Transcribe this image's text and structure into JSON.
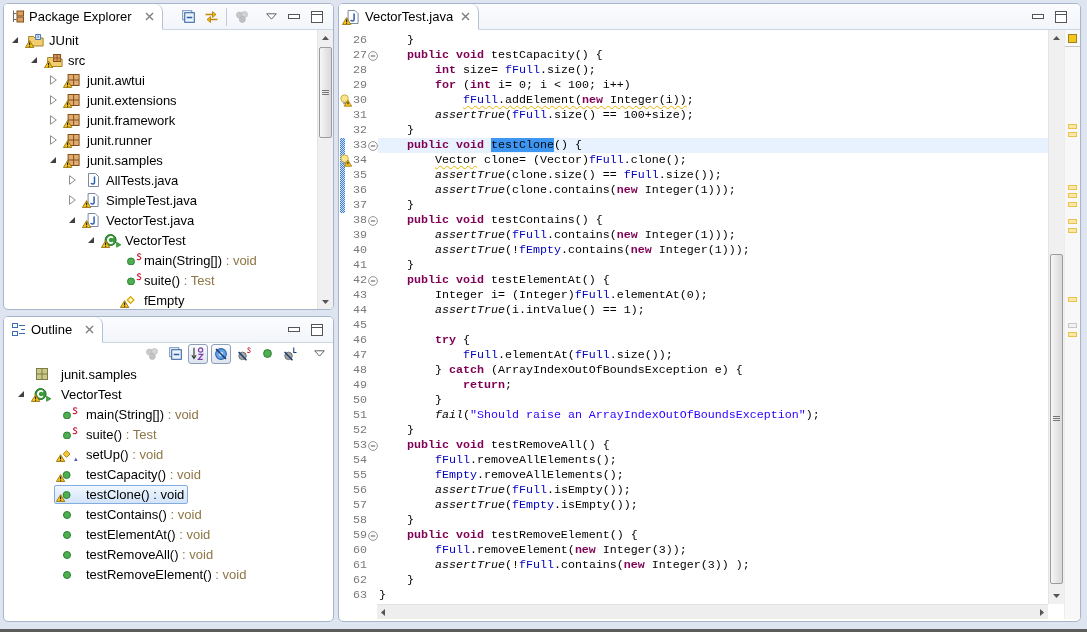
{
  "package_explorer": {
    "tab": {
      "label": "Package Explorer",
      "selected": true
    },
    "toolbar_groups": [
      {
        "items": [
          {
            "kind": "collapse-all",
            "disabled": false
          },
          {
            "kind": "link-with-editor",
            "disabled": false
          }
        ]
      },
      {
        "items": [
          {
            "kind": "focus-on-task",
            "disabled": true
          },
          {
            "kind": "view-menu",
            "disabled": false
          }
        ]
      }
    ],
    "tree": [
      {
        "label": "JUnit",
        "kind": "project",
        "warning": true,
        "expanded": true,
        "children": [
          {
            "label": "src",
            "kind": "source-folder",
            "warning": true,
            "expanded": true,
            "children": [
              {
                "label": "junit.awtui",
                "kind": "package",
                "warning": true,
                "expanded": false
              },
              {
                "label": "junit.extensions",
                "kind": "package",
                "warning": true,
                "expanded": false
              },
              {
                "label": "junit.framework",
                "kind": "package",
                "warning": true,
                "expanded": false
              },
              {
                "label": "junit.runner",
                "kind": "package",
                "warning": true,
                "expanded": false
              },
              {
                "label": "junit.samples",
                "kind": "package",
                "warning": true,
                "expanded": true,
                "children": [
                  {
                    "label": "AllTests.java",
                    "kind": "java-file",
                    "warning": false,
                    "expanded": false
                  },
                  {
                    "label": "SimpleTest.java",
                    "kind": "java-file",
                    "warning": true,
                    "expanded": false
                  },
                  {
                    "label": "VectorTest.java",
                    "kind": "java-file",
                    "warning": true,
                    "expanded": true,
                    "children": [
                      {
                        "label": "VectorTest",
                        "kind": "class",
                        "warning": true,
                        "expanded": true,
                        "children": [
                          {
                            "label": "main(String[])",
                            "detail": ": void",
                            "kind": "method",
                            "warning": false,
                            "static": true
                          },
                          {
                            "label": "suite()",
                            "detail": ": Test",
                            "kind": "method",
                            "warning": false,
                            "static": true
                          },
                          {
                            "label": "fEmpty",
                            "kind": "field",
                            "warning": true,
                            "static": false
                          }
                        ]
                      }
                    ]
                  }
                ]
              }
            ]
          }
        ]
      }
    ]
  },
  "outline": {
    "tab": {
      "label": "Outline",
      "selected": true
    },
    "toolbar": [
      {
        "kind": "focus-on-task",
        "disabled": true,
        "pressed": false
      },
      {
        "kind": "collapse-all",
        "disabled": false,
        "pressed": false
      },
      {
        "kind": "sort",
        "disabled": false,
        "pressed": true
      },
      {
        "kind": "hide-fields",
        "disabled": false,
        "pressed": true
      },
      {
        "kind": "hide-static",
        "disabled": false,
        "pressed": false
      },
      {
        "kind": "hide-non-public",
        "disabled": false,
        "pressed": false
      },
      {
        "kind": "hide-local-types",
        "disabled": false,
        "pressed": false
      },
      {
        "kind": "view-menu",
        "disabled": false,
        "pressed": false
      }
    ],
    "tree": [
      {
        "label": "junit.samples",
        "kind": "package-declaration",
        "warning": false,
        "selected": false
      },
      {
        "label": "VectorTest",
        "kind": "class",
        "warning": true,
        "selected": false,
        "expanded": true,
        "children": [
          {
            "label": "main(String[])",
            "detail": ": void",
            "kind": "method",
            "static": true,
            "override": false,
            "warning": false,
            "selected": false
          },
          {
            "label": "suite()",
            "detail": ": Test",
            "kind": "method",
            "static": true,
            "override": false,
            "warning": false,
            "selected": false
          },
          {
            "label": "setUp()",
            "detail": ": void",
            "kind": "protected-method",
            "static": false,
            "override": true,
            "warning": true,
            "selected": false
          },
          {
            "label": "testCapacity()",
            "detail": ": void",
            "kind": "method",
            "static": false,
            "override": false,
            "warning": true,
            "selected": false
          },
          {
            "label": "testClone()",
            "detail": ": void",
            "kind": "method",
            "static": false,
            "override": false,
            "warning": true,
            "selected": true
          },
          {
            "label": "testContains()",
            "detail": ": void",
            "kind": "method",
            "static": false,
            "override": false,
            "warning": false,
            "selected": false
          },
          {
            "label": "testElementAt()",
            "detail": ": void",
            "kind": "method",
            "static": false,
            "override": false,
            "warning": false,
            "selected": false
          },
          {
            "label": "testRemoveAll()",
            "detail": ": void",
            "kind": "method",
            "static": false,
            "override": false,
            "warning": false,
            "selected": false
          },
          {
            "label": "testRemoveElement()",
            "detail": ": void",
            "kind": "method",
            "static": false,
            "override": false,
            "warning": false,
            "selected": false
          }
        ]
      }
    ]
  },
  "editor": {
    "tab": {
      "label": "VectorTest.java",
      "selected": true,
      "warning": true
    },
    "lines": [
      {
        "number": "26",
        "folding": false,
        "warning": false,
        "changed": false,
        "current": false,
        "tokens": [
          {
            "text": "    }",
            "kind": "plain"
          }
        ]
      },
      {
        "number": "27",
        "folding": true,
        "warning": false,
        "changed": false,
        "current": false,
        "tokens": [
          {
            "text": "    public void ",
            "kind": "keyword"
          },
          {
            "text": "testCapacity() {",
            "kind": "plain"
          }
        ]
      },
      {
        "number": "28",
        "folding": false,
        "warning": false,
        "changed": false,
        "current": false,
        "tokens": [
          {
            "text": "        int",
            "kind": "keyword"
          },
          {
            "text": " size= ",
            "kind": "plain"
          },
          {
            "text": "fFull",
            "kind": "field"
          },
          {
            "text": ".size();",
            "kind": "plain"
          }
        ]
      },
      {
        "number": "29",
        "folding": false,
        "warning": false,
        "changed": false,
        "current": false,
        "tokens": [
          {
            "text": "        for",
            "kind": "keyword"
          },
          {
            "text": " (",
            "kind": "plain"
          },
          {
            "text": "int",
            "kind": "keyword"
          },
          {
            "text": " i= 0; i < 100; i++)",
            "kind": "plain"
          }
        ]
      },
      {
        "number": "30",
        "folding": false,
        "warning": true,
        "changed": false,
        "current": false,
        "tokens": [
          {
            "kind": "warning",
            "tokens": [
              {
                "text": "            fFull",
                "kind": "field"
              },
              {
                "text": ".addElement(",
                "kind": "plain"
              },
              {
                "text": "new",
                "kind": "keyword"
              },
              {
                "text": " Integer(i))",
                "kind": "plain"
              }
            ]
          },
          {
            "text": ";",
            "kind": "plain"
          }
        ]
      },
      {
        "number": "31",
        "folding": false,
        "warning": false,
        "changed": false,
        "current": false,
        "tokens": [
          {
            "text": "        assertTrue",
            "kind": "static"
          },
          {
            "text": "(",
            "kind": "plain"
          },
          {
            "text": "fFull",
            "kind": "field"
          },
          {
            "text": ".size() == 100+size);",
            "kind": "plain"
          }
        ]
      },
      {
        "number": "32",
        "folding": false,
        "warning": false,
        "changed": false,
        "current": false,
        "tokens": [
          {
            "text": "    }",
            "kind": "plain"
          }
        ]
      },
      {
        "number": "33",
        "folding": true,
        "warning": false,
        "changed": true,
        "current": true,
        "tokens": [
          {
            "text": "    public void ",
            "kind": "keyword"
          },
          {
            "text": "testClone",
            "kind": "selection"
          },
          {
            "text": "() {",
            "kind": "plain"
          }
        ]
      },
      {
        "number": "34",
        "folding": false,
        "warning": true,
        "changed": true,
        "current": false,
        "tokens": [
          {
            "kind": "warning",
            "tokens": [
              {
                "text": "        Vector",
                "kind": "plain"
              }
            ]
          },
          {
            "text": " clone= (Vector)",
            "kind": "plain"
          },
          {
            "text": "fFull",
            "kind": "field"
          },
          {
            "text": ".clone();",
            "kind": "plain"
          }
        ]
      },
      {
        "number": "35",
        "folding": false,
        "warning": false,
        "changed": true,
        "current": false,
        "tokens": [
          {
            "text": "        assertTrue",
            "kind": "static"
          },
          {
            "text": "(clone.size() == ",
            "kind": "plain"
          },
          {
            "text": "fFull",
            "kind": "field"
          },
          {
            "text": ".size());",
            "kind": "plain"
          }
        ]
      },
      {
        "number": "36",
        "folding": false,
        "warning": false,
        "changed": true,
        "current": false,
        "tokens": [
          {
            "text": "        assertTrue",
            "kind": "static"
          },
          {
            "text": "(clone.contains(",
            "kind": "plain"
          },
          {
            "text": "new",
            "kind": "keyword"
          },
          {
            "text": " Integer(1)));",
            "kind": "plain"
          }
        ]
      },
      {
        "number": "37",
        "folding": false,
        "warning": false,
        "changed": true,
        "current": false,
        "tokens": [
          {
            "text": "    }",
            "kind": "plain"
          }
        ]
      },
      {
        "number": "38",
        "folding": true,
        "warning": false,
        "changed": false,
        "current": false,
        "tokens": [
          {
            "text": "    public void ",
            "kind": "keyword"
          },
          {
            "text": "testContains() {",
            "kind": "plain"
          }
        ]
      },
      {
        "number": "39",
        "folding": false,
        "warning": false,
        "changed": false,
        "current": false,
        "tokens": [
          {
            "text": "        assertTrue",
            "kind": "static"
          },
          {
            "text": "(",
            "kind": "plain"
          },
          {
            "text": "fFull",
            "kind": "field"
          },
          {
            "text": ".contains(",
            "kind": "plain"
          },
          {
            "text": "new",
            "kind": "keyword"
          },
          {
            "text": " Integer(1)));",
            "kind": "plain"
          }
        ]
      },
      {
        "number": "40",
        "folding": false,
        "warning": false,
        "changed": false,
        "current": false,
        "tokens": [
          {
            "text": "        assertTrue",
            "kind": "static"
          },
          {
            "text": "(!",
            "kind": "plain"
          },
          {
            "text": "fEmpty",
            "kind": "field"
          },
          {
            "text": ".contains(",
            "kind": "plain"
          },
          {
            "text": "new",
            "kind": "keyword"
          },
          {
            "text": " Integer(1)));",
            "kind": "plain"
          }
        ]
      },
      {
        "number": "41",
        "folding": false,
        "warning": false,
        "changed": false,
        "current": false,
        "tokens": [
          {
            "text": "    }",
            "kind": "plain"
          }
        ]
      },
      {
        "number": "42",
        "folding": true,
        "warning": false,
        "changed": false,
        "current": false,
        "tokens": [
          {
            "text": "    public void ",
            "kind": "keyword"
          },
          {
            "text": "testElementAt() {",
            "kind": "plain"
          }
        ]
      },
      {
        "number": "43",
        "folding": false,
        "warning": false,
        "changed": false,
        "current": false,
        "tokens": [
          {
            "text": "        Integer i= (Integer)",
            "kind": "plain"
          },
          {
            "text": "fFull",
            "kind": "field"
          },
          {
            "text": ".elementAt(0);",
            "kind": "plain"
          }
        ]
      },
      {
        "number": "44",
        "folding": false,
        "warning": false,
        "changed": false,
        "current": false,
        "tokens": [
          {
            "text": "        assertTrue",
            "kind": "static"
          },
          {
            "text": "(i.intValue() == 1);",
            "kind": "plain"
          }
        ]
      },
      {
        "number": "45",
        "folding": false,
        "warning": false,
        "changed": false,
        "current": false
      },
      {
        "number": "46",
        "folding": false,
        "warning": false,
        "changed": false,
        "current": false,
        "tokens": [
          {
            "text": "        try",
            "kind": "keyword"
          },
          {
            "text": " {",
            "kind": "plain"
          }
        ]
      },
      {
        "number": "47",
        "folding": false,
        "warning": false,
        "changed": false,
        "current": false,
        "tokens": [
          {
            "text": "            fFull",
            "kind": "field"
          },
          {
            "text": ".elementAt(",
            "kind": "plain"
          },
          {
            "text": "fFull",
            "kind": "field"
          },
          {
            "text": ".size());",
            "kind": "plain"
          }
        ]
      },
      {
        "number": "48",
        "folding": false,
        "warning": false,
        "changed": false,
        "current": false,
        "tokens": [
          {
            "text": "        } ",
            "kind": "plain"
          },
          {
            "text": "catch",
            "kind": "keyword"
          },
          {
            "text": " (ArrayIndexOutOfBoundsException e) {",
            "kind": "plain"
          }
        ]
      },
      {
        "number": "49",
        "folding": false,
        "warning": false,
        "changed": false,
        "current": false,
        "tokens": [
          {
            "text": "            return",
            "kind": "keyword"
          },
          {
            "text": ";",
            "kind": "plain"
          }
        ]
      },
      {
        "number": "50",
        "folding": false,
        "warning": false,
        "changed": false,
        "current": false,
        "tokens": [
          {
            "text": "        }",
            "kind": "plain"
          }
        ]
      },
      {
        "number": "51",
        "folding": false,
        "warning": false,
        "changed": false,
        "current": false,
        "tokens": [
          {
            "text": "        fail",
            "kind": "static"
          },
          {
            "text": "(",
            "kind": "plain"
          },
          {
            "text": "\"Should raise an ArrayIndexOutOfBoundsException\"",
            "kind": "string"
          },
          {
            "text": ");",
            "kind": "plain"
          }
        ]
      },
      {
        "number": "52",
        "folding": false,
        "warning": false,
        "changed": false,
        "current": false,
        "tokens": [
          {
            "text": "    }",
            "kind": "plain"
          }
        ]
      },
      {
        "number": "53",
        "folding": true,
        "warning": false,
        "changed": false,
        "current": false,
        "tokens": [
          {
            "text": "    public void ",
            "kind": "keyword"
          },
          {
            "text": "testRemoveAll() {",
            "kind": "plain"
          }
        ]
      },
      {
        "number": "54",
        "folding": false,
        "warning": false,
        "changed": false,
        "current": false,
        "tokens": [
          {
            "text": "        fFull",
            "kind": "field"
          },
          {
            "text": ".removeAllElements();",
            "kind": "plain"
          }
        ]
      },
      {
        "number": "55",
        "folding": false,
        "warning": false,
        "changed": false,
        "current": false,
        "tokens": [
          {
            "text": "        fEmpty",
            "kind": "field"
          },
          {
            "text": ".removeAllElements();",
            "kind": "plain"
          }
        ]
      },
      {
        "number": "56",
        "folding": false,
        "warning": false,
        "changed": false,
        "current": false,
        "tokens": [
          {
            "text": "        assertTrue",
            "kind": "static"
          },
          {
            "text": "(",
            "kind": "plain"
          },
          {
            "text": "fFull",
            "kind": "field"
          },
          {
            "text": ".isEmpty());",
            "kind": "plain"
          }
        ]
      },
      {
        "number": "57",
        "folding": false,
        "warning": false,
        "changed": false,
        "current": false,
        "tokens": [
          {
            "text": "        assertTrue",
            "kind": "static"
          },
          {
            "text": "(",
            "kind": "plain"
          },
          {
            "text": "fEmpty",
            "kind": "field"
          },
          {
            "text": ".isEmpty());",
            "kind": "plain"
          }
        ]
      },
      {
        "number": "58",
        "folding": false,
        "warning": false,
        "changed": false,
        "current": false,
        "tokens": [
          {
            "text": "    }",
            "kind": "plain"
          }
        ]
      },
      {
        "number": "59",
        "folding": true,
        "warning": false,
        "changed": false,
        "current": false,
        "tokens": [
          {
            "text": "    public void ",
            "kind": "keyword"
          },
          {
            "text": "testRemoveElement() {",
            "kind": "plain"
          }
        ]
      },
      {
        "number": "60",
        "folding": false,
        "warning": false,
        "changed": false,
        "current": false,
        "tokens": [
          {
            "text": "        fFull",
            "kind": "field"
          },
          {
            "text": ".removeElement(",
            "kind": "plain"
          },
          {
            "text": "new",
            "kind": "keyword"
          },
          {
            "text": " Integer(3));",
            "kind": "plain"
          }
        ]
      },
      {
        "number": "61",
        "folding": false,
        "warning": false,
        "changed": false,
        "current": false,
        "tokens": [
          {
            "text": "        assertTrue",
            "kind": "static"
          },
          {
            "text": "(!",
            "kind": "plain"
          },
          {
            "text": "fFull",
            "kind": "field"
          },
          {
            "text": ".contains(",
            "kind": "plain"
          },
          {
            "text": "new",
            "kind": "keyword"
          },
          {
            "text": " Integer(3)) );",
            "kind": "plain"
          }
        ]
      },
      {
        "number": "62",
        "folding": false,
        "warning": false,
        "changed": false,
        "current": false,
        "tokens": [
          {
            "text": "    }",
            "kind": "plain"
          }
        ]
      },
      {
        "number": "63",
        "folding": false,
        "warning": false,
        "changed": false,
        "current": false,
        "tokens": [
          {
            "text": "}",
            "kind": "plain"
          }
        ]
      }
    ]
  }
}
